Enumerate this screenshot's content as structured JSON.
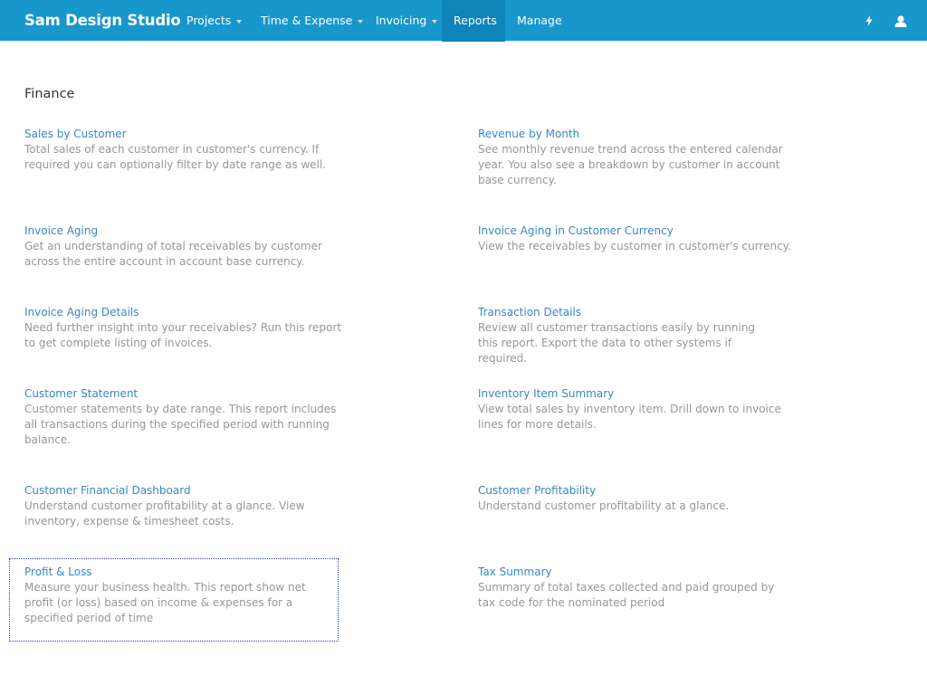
{
  "navbar": {
    "brand": "Sam Design Studio",
    "items": [
      {
        "label": "Projects",
        "dropdown": true,
        "active": false
      },
      {
        "label": "Time & Expense",
        "dropdown": true,
        "active": false
      },
      {
        "label": "Invoicing",
        "dropdown": true,
        "active": false
      },
      {
        "label": "Reports",
        "dropdown": false,
        "active": true
      },
      {
        "label": "Manage",
        "dropdown": false,
        "active": false
      }
    ],
    "icons": [
      "lightning-bolt-icon",
      "user-icon"
    ],
    "colors": {
      "background": "#1797cc",
      "active": "#0f84b8"
    }
  },
  "section": {
    "title": "Finance"
  },
  "reports": [
    {
      "title": "Sales by Customer",
      "description": "Total sales of each customer in customer's currency. If required you can optionally filter by date range as well."
    },
    {
      "title": "Revenue by Month",
      "description": "See monthly revenue trend across the entered calendar year. You also see a breakdown by customer in account base currency."
    },
    {
      "title": "Invoice Aging",
      "description": "Get an understanding of total receivables by customer across the entire account in account base currency."
    },
    {
      "title": "Invoice Aging in Customer Currency",
      "description": "View the receivables by customer in customer's currency."
    },
    {
      "title": "Invoice Aging Details",
      "description": "Need further insight into your receivables? Run this report to get complete listing of invoices."
    },
    {
      "title": "Transaction Details",
      "description": "Review all customer transactions easily by running this report. Export the data to other systems if required."
    },
    {
      "title": "Customer Statement",
      "description": "Customer statements by date range. This report includes all transactions during the specified period with running balance."
    },
    {
      "title": "Inventory Item Summary",
      "description": "View total sales by inventory item. Drill down to invoice lines for more details."
    },
    {
      "title": "Customer Financial Dashboard",
      "description": "Understand customer profitability at a glance. View inventory, expense & timesheet costs."
    },
    {
      "title": "Customer Profitability",
      "description": "Understand customer profitability at a glance."
    },
    {
      "title": "Profit & Loss",
      "description": "Measure your business health. This report show net profit (or loss) based on income & expenses for a specified period of time",
      "focused": true
    },
    {
      "title": "Tax Summary",
      "description": "Summary of total taxes collected and paid grouped by tax code for the nominated period"
    }
  ],
  "colors": {
    "link": "#3a87c8",
    "description": "#979797",
    "focus_outline": "#1f3fe0"
  }
}
